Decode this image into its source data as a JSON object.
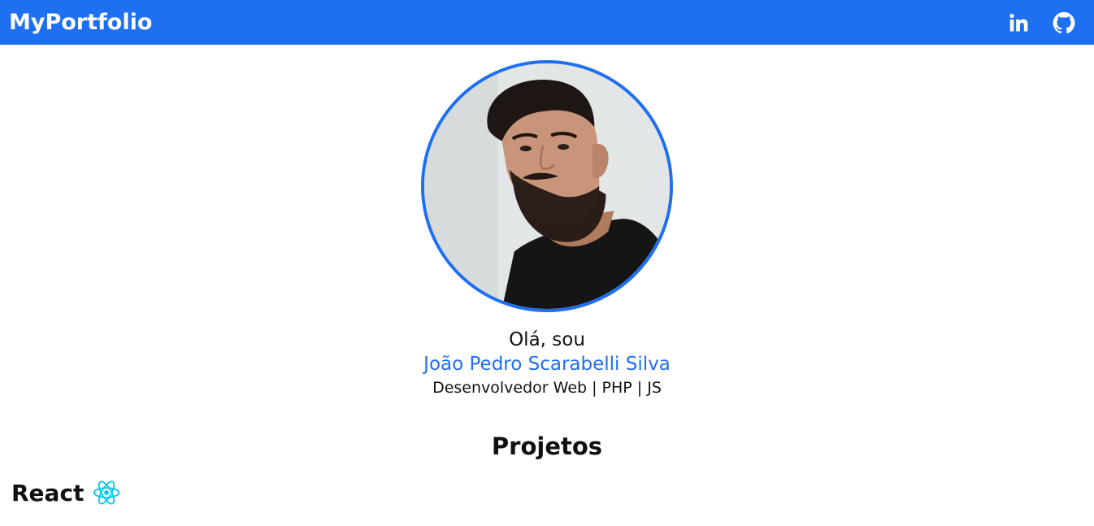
{
  "navbar": {
    "brand": "MyPortfolio",
    "links": [
      {
        "icon": "linkedin-icon"
      },
      {
        "icon": "github-icon"
      }
    ],
    "background": "#1e6ff2"
  },
  "hero": {
    "greeting": "Olá, sou",
    "name": "João Pedro Scarabelli Silva",
    "role": "Desenvolvedor Web | PHP | JS",
    "accent": "#1e6ff2"
  },
  "projects": {
    "title": "Projetos",
    "categories": [
      {
        "label": "React",
        "icon": "react-icon",
        "icon_color": "#00c8f0"
      }
    ]
  }
}
